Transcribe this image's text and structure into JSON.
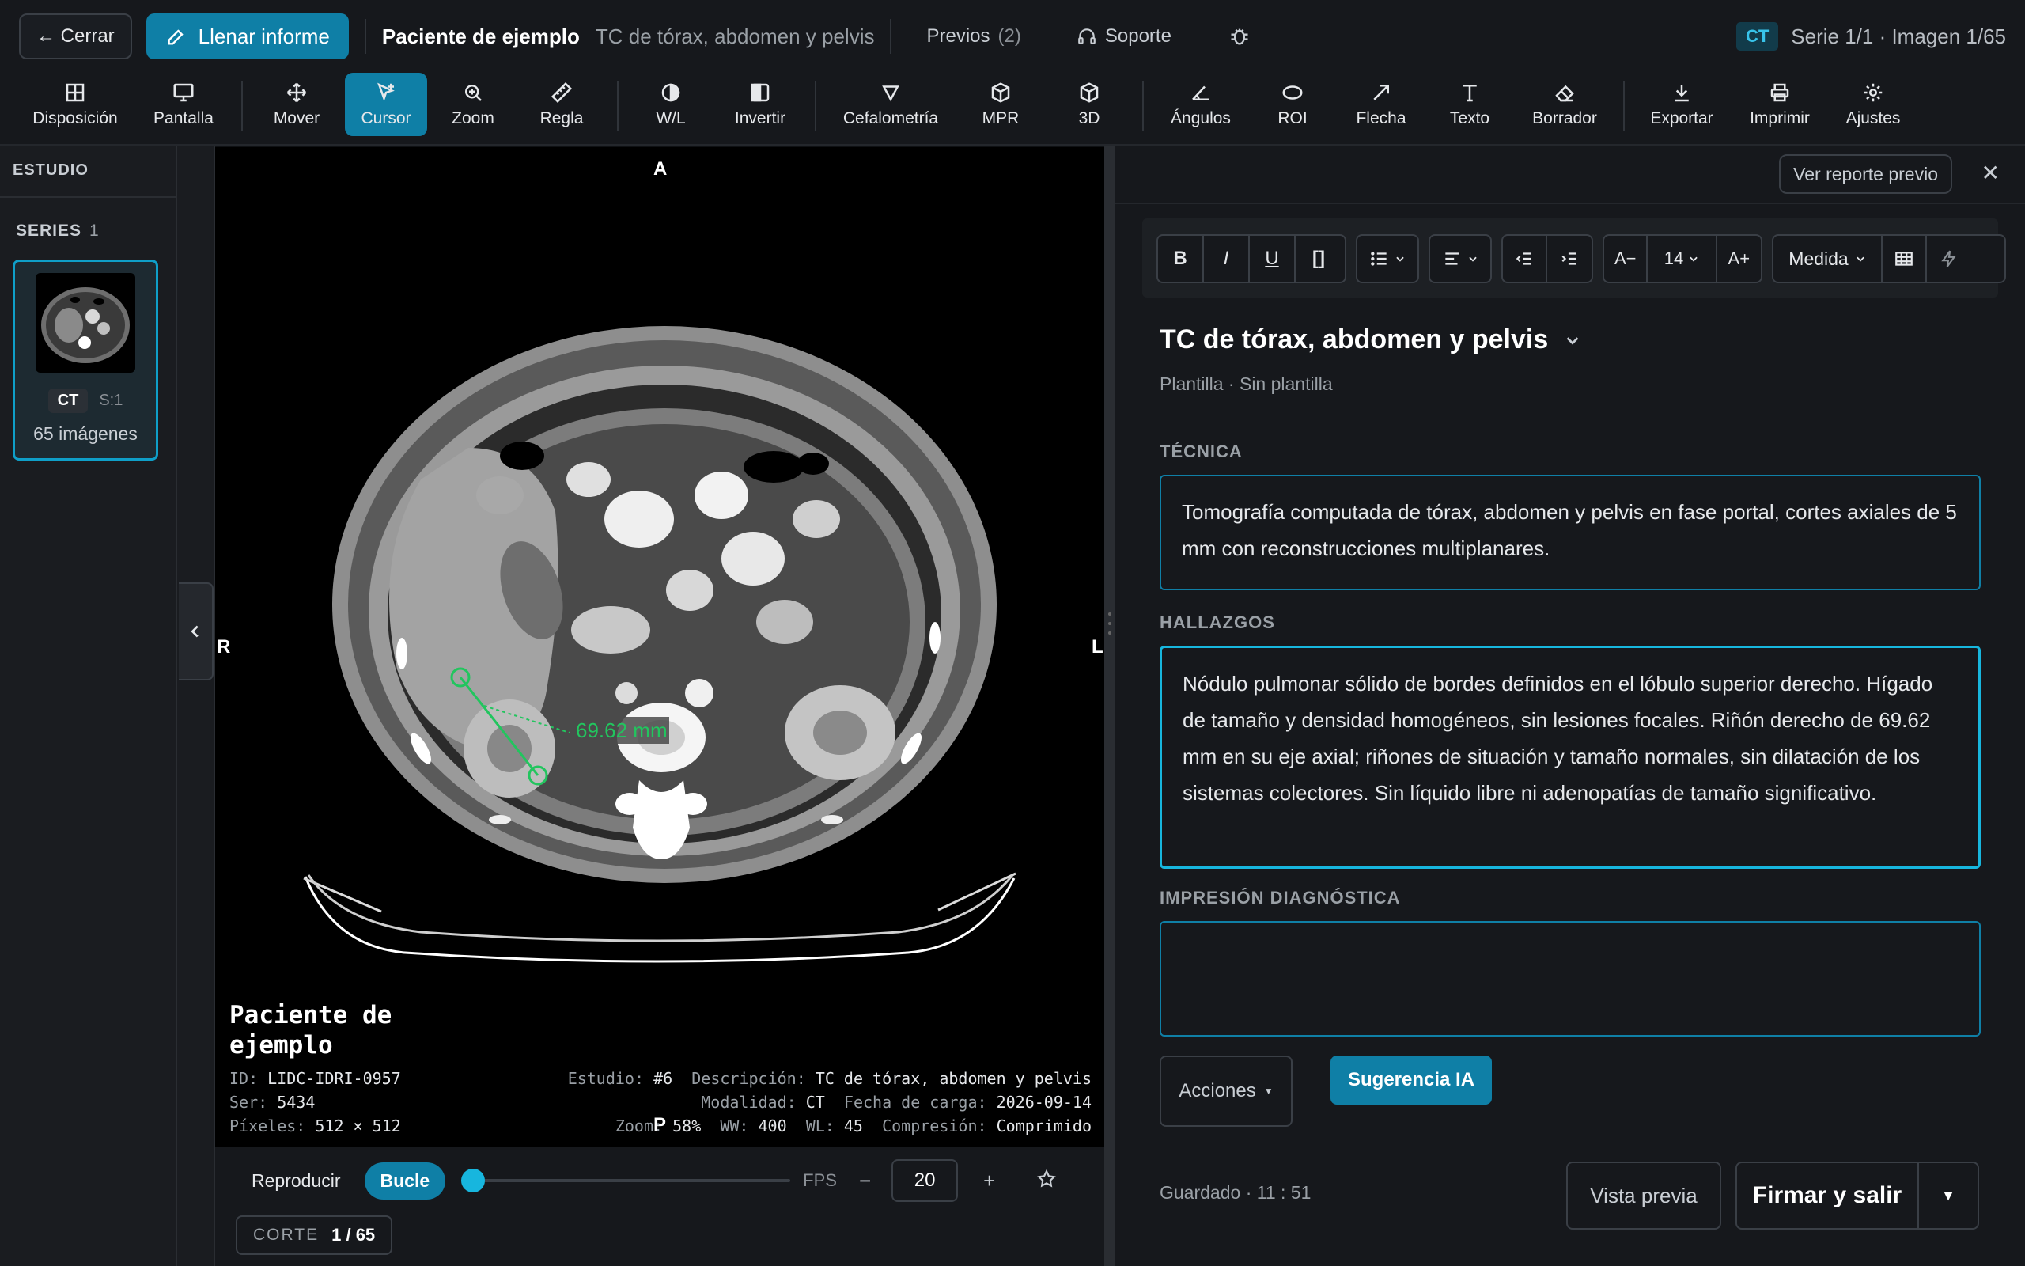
{
  "topbar": {
    "close_label": "← Cerrar",
    "fill_report_label": "Llenar informe",
    "patient_name": "Paciente de ejemplo",
    "study_description": "TC de tórax, abdomen y pelvis",
    "previous_label": "Previos",
    "previous_count": "(2)",
    "support_label": "Soporte",
    "modality_badge": "CT",
    "series_image_status": "Serie 1/1 · Imagen 1/65"
  },
  "toolbar": {
    "tools": [
      {
        "label": "Disposición",
        "icon": "layout-grid-icon"
      },
      {
        "label": "Pantalla",
        "icon": "monitor-icon"
      },
      {
        "label": "Mover",
        "icon": "move-icon"
      },
      {
        "label": "Cursor",
        "icon": "cursor-icon",
        "active": true
      },
      {
        "label": "Zoom",
        "icon": "zoom-icon"
      },
      {
        "label": "Regla",
        "icon": "ruler-icon"
      },
      {
        "label": "W/L",
        "icon": "contrast-icon"
      },
      {
        "label": "Invertir",
        "icon": "invert-icon"
      },
      {
        "label": "Cefalometría",
        "icon": "cephalometry-icon"
      },
      {
        "label": "MPR",
        "icon": "cube-icon"
      },
      {
        "label": "3D",
        "icon": "cube-3d-icon"
      },
      {
        "label": "Ángulos",
        "icon": "angle-icon"
      },
      {
        "label": "ROI",
        "icon": "ellipse-icon"
      },
      {
        "label": "Flecha",
        "icon": "arrow-icon"
      },
      {
        "label": "Texto",
        "icon": "text-icon"
      },
      {
        "label": "Borrador",
        "icon": "eraser-icon"
      },
      {
        "label": "Exportar",
        "icon": "download-icon"
      },
      {
        "label": "Imprimir",
        "icon": "printer-icon"
      },
      {
        "label": "Ajustes",
        "icon": "gear-icon"
      }
    ]
  },
  "left_panel": {
    "study_heading": "ESTUDIO",
    "series_heading": "SERIES",
    "series_count": "1",
    "series": [
      {
        "modality": "CT",
        "number": "S:1",
        "images": "65 imágenes"
      }
    ]
  },
  "viewer": {
    "orientation": {
      "top": "A",
      "left": "R",
      "right": "L",
      "bottom": "P"
    },
    "measurement": "69.62 mm",
    "overlay": {
      "patient_name": "Paciente de ejemplo",
      "id_label": "ID:",
      "id_value": "LIDC-IDRI-0957",
      "ser_label": "Ser:",
      "ser_value": "5434",
      "pixels_label": "Píxeles:",
      "pixels_value": "512 × 512",
      "study_label": "Estudio:",
      "study_value": "#6",
      "desc_label": "Descripción:",
      "desc_value": "TC de tórax, abdomen y pelvis",
      "modality_label": "Modalidad:",
      "modality_value": "CT",
      "load_date_label": "Fecha de carga:",
      "load_date_value": "2026-09-14",
      "zoom_label": "Zoom:",
      "zoom_value": "58%",
      "ww_label": "WW:",
      "ww_value": "400",
      "wl_label": "WL:",
      "wl_value": "45",
      "compression_label": "Compresión:",
      "compression_value": "Comprimido"
    }
  },
  "playback": {
    "play_label": "Reproducir",
    "loop_label": "Bucle",
    "fps_label": "FPS",
    "minus": "−",
    "plus": "+",
    "fps_value": "20",
    "slider_position": 0.0,
    "corte_label": "CORTE",
    "corte_value": "1 / 65"
  },
  "report": {
    "view_previous_label": "Ver reporte previo",
    "close_symbol": "✕",
    "editor": {
      "bold": "B",
      "italic": "I",
      "underline": "U",
      "brackets": "[]",
      "font_decrease": "A−",
      "font_size": "14",
      "font_increase": "A+",
      "measure_label": "Medida"
    },
    "title": "TC de tórax, abdomen y pelvis",
    "template": "Plantilla · Sin plantilla",
    "technique_label": "TÉCNICA",
    "technique_text": "Tomografía computada de tórax, abdomen y pelvis en fase portal, cortes axiales de 5 mm con reconstrucciones multiplanares.",
    "findings_label": "HALLAZGOS",
    "findings_text": "Nódulo pulmonar sólido de bordes definidos en el lóbulo superior derecho. Hígado de tamaño y densidad homogéneos, sin lesiones focales. Riñón derecho de 69.62 mm en su eje axial; riñones de situación y tamaño normales, sin dilatación de los sistemas colectores. Sin líquido libre ni adenopatías de tamaño significativo.",
    "impression_label": "IMPRESIÓN DIAGNÓSTICA",
    "impression_text": "",
    "actions_label": "Acciones",
    "ai_label": "Sugerencia IA",
    "saved_status": "Guardado · 11 : 51",
    "preview_label": "Vista previa",
    "sign_label": "Firmar y salir"
  },
  "colors": {
    "accent": "#0f7fa6",
    "accent_bright": "#17b6de",
    "measurement_green": "#22c55e",
    "background": "#16181c"
  }
}
